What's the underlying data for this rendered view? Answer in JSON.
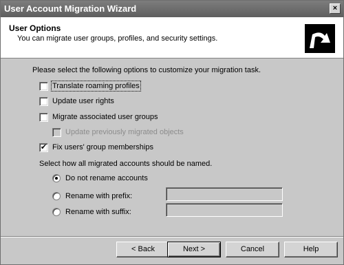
{
  "window": {
    "title": "User Account Migration Wizard",
    "close_glyph": "×"
  },
  "header": {
    "title": "User Options",
    "subtitle": "You can migrate user groups, profiles, and security settings.",
    "icon": "wizard-arrow-icon"
  },
  "instructions": "Please select the following options to customize your migration task.",
  "options": {
    "translate_roaming_profiles": {
      "label": "Translate roaming profiles",
      "checked": false
    },
    "update_user_rights": {
      "label": "Update user rights",
      "checked": false
    },
    "migrate_associated_groups": {
      "label": "Migrate associated user groups",
      "checked": false
    },
    "update_previously_migrated": {
      "label": "Update previously migrated objects",
      "checked": false,
      "disabled": true
    },
    "fix_group_memberships": {
      "label": "Fix users' group memberships",
      "checked": true
    }
  },
  "naming": {
    "prompt": "Select how all migrated accounts should be named.",
    "do_not_rename": {
      "label": "Do not rename accounts",
      "selected": true
    },
    "rename_prefix": {
      "label": "Rename with prefix:",
      "selected": false,
      "value": ""
    },
    "rename_suffix": {
      "label": "Rename with suffix:",
      "selected": false,
      "value": ""
    }
  },
  "buttons": {
    "back": "< Back",
    "next": "Next >",
    "cancel": "Cancel",
    "help": "Help"
  }
}
